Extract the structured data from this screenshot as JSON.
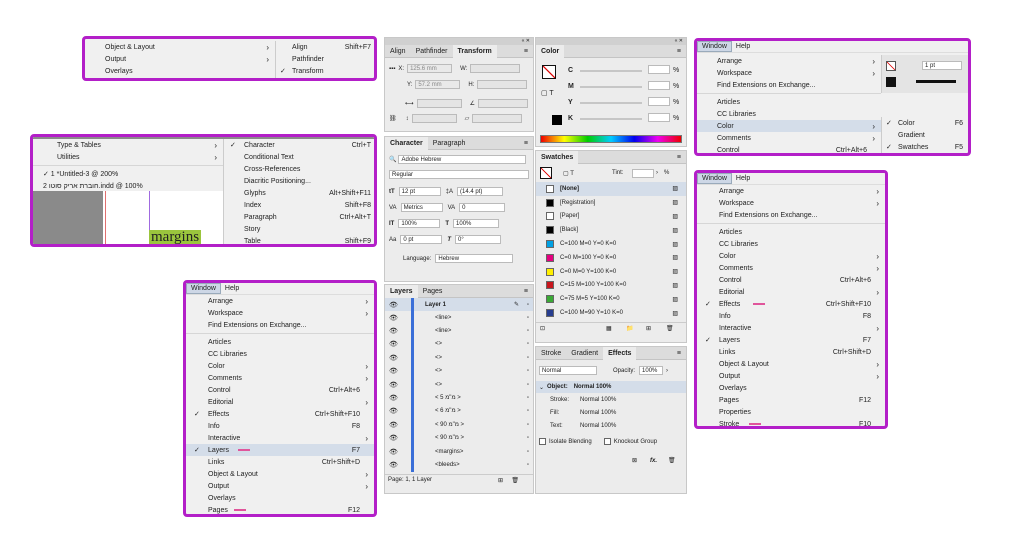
{
  "box1": {
    "items": [
      {
        "label": "Object & Layout",
        "arrow": "›"
      },
      {
        "label": "Output",
        "arrow": "›"
      },
      {
        "label": "Overlays",
        "arrow": ""
      }
    ],
    "sub": [
      {
        "label": "Align",
        "sc": "Shift+F7",
        "check": ""
      },
      {
        "label": "Pathfinder",
        "sc": "",
        "check": ""
      },
      {
        "label": "Transform",
        "sc": "",
        "check": "✓"
      }
    ]
  },
  "box2": {
    "items": [
      {
        "label": "Type & Tables",
        "arrow": "›"
      },
      {
        "label": "Utilities",
        "arrow": "›"
      }
    ],
    "docs": [
      "✓ 1 *Untitled-3 @ 200%",
      "2 חוברת אריק סוטו.indd @ 100%"
    ],
    "sub": [
      {
        "label": "Character",
        "sc": "Ctrl+T",
        "check": "✓"
      },
      {
        "label": "Conditional Text",
        "sc": "",
        "check": ""
      },
      {
        "label": "Cross-References",
        "sc": "",
        "check": ""
      },
      {
        "label": "Diacritic Positioning...",
        "sc": "",
        "check": ""
      },
      {
        "label": "Glyphs",
        "sc": "Alt+Shift+F11",
        "check": ""
      },
      {
        "label": "Index",
        "sc": "Shift+F8",
        "check": ""
      },
      {
        "label": "Paragraph",
        "sc": "Ctrl+Alt+T",
        "check": ""
      },
      {
        "label": "Story",
        "sc": "",
        "check": ""
      },
      {
        "label": "Table",
        "sc": "Shift+F9",
        "check": ""
      }
    ],
    "canvas_text": "margins"
  },
  "menubar": {
    "window": "Window",
    "help": "Help"
  },
  "box3": {
    "items": [
      {
        "label": "Arrange",
        "sc": "",
        "arrow": "›",
        "check": ""
      },
      {
        "label": "Workspace",
        "sc": "",
        "arrow": "›",
        "check": ""
      },
      {
        "label": "Find Extensions on Exchange...",
        "sc": "",
        "arrow": "",
        "check": ""
      },
      {
        "sep": true
      },
      {
        "label": "Articles",
        "sc": "",
        "arrow": "",
        "check": ""
      },
      {
        "label": "CC Libraries",
        "sc": "",
        "arrow": "",
        "check": ""
      },
      {
        "label": "Color",
        "sc": "",
        "arrow": "›",
        "check": ""
      },
      {
        "label": "Comments",
        "sc": "",
        "arrow": "›",
        "check": ""
      },
      {
        "label": "Control",
        "sc": "Ctrl+Alt+6",
        "arrow": "",
        "check": ""
      },
      {
        "label": "Editorial",
        "sc": "",
        "arrow": "›",
        "check": ""
      },
      {
        "label": "Effects",
        "sc": "Ctrl+Shift+F10",
        "arrow": "",
        "check": "✓"
      },
      {
        "label": "Info",
        "sc": "F8",
        "arrow": "",
        "check": ""
      },
      {
        "label": "Interactive",
        "sc": "",
        "arrow": "›",
        "check": ""
      },
      {
        "label": "Layers",
        "sc": "F7",
        "arrow": "",
        "check": "✓",
        "hl": true,
        "ul": true
      },
      {
        "label": "Links",
        "sc": "Ctrl+Shift+D",
        "arrow": "",
        "check": ""
      },
      {
        "label": "Object & Layout",
        "sc": "",
        "arrow": "›",
        "check": ""
      },
      {
        "label": "Output",
        "sc": "",
        "arrow": "›",
        "check": ""
      },
      {
        "label": "Overlays",
        "sc": "",
        "arrow": "",
        "check": ""
      },
      {
        "label": "Pages",
        "sc": "F12",
        "arrow": "",
        "check": "",
        "ul": true
      }
    ]
  },
  "box4": {
    "items": [
      {
        "label": "Arrange",
        "sc": "",
        "arrow": "›"
      },
      {
        "label": "Workspace",
        "sc": "",
        "arrow": "›"
      },
      {
        "label": "Find Extensions on Exchange...",
        "sc": "",
        "arrow": ""
      },
      {
        "sep": true
      },
      {
        "label": "Articles",
        "sc": "",
        "arrow": ""
      },
      {
        "label": "CC Libraries",
        "sc": "",
        "arrow": ""
      },
      {
        "label": "Color",
        "sc": "",
        "arrow": "›",
        "hl": true
      },
      {
        "label": "Comments",
        "sc": "",
        "arrow": "›"
      },
      {
        "label": "Control",
        "sc": "Ctrl+Alt+6",
        "arrow": ""
      }
    ],
    "sub": [
      {
        "label": "Color",
        "sc": "F6",
        "check": "✓"
      },
      {
        "label": "Gradient",
        "sc": "",
        "check": ""
      },
      {
        "label": "Swatches",
        "sc": "F5",
        "check": "✓"
      }
    ],
    "stroke_val": "1 pt"
  },
  "box5": {
    "items": [
      {
        "label": "Arrange",
        "sc": "",
        "arrow": "›",
        "check": ""
      },
      {
        "label": "Workspace",
        "sc": "",
        "arrow": "›",
        "check": ""
      },
      {
        "label": "Find Extensions on Exchange...",
        "sc": "",
        "arrow": "",
        "check": ""
      },
      {
        "sep": true
      },
      {
        "label": "Articles",
        "sc": "",
        "arrow": "",
        "check": ""
      },
      {
        "label": "CC Libraries",
        "sc": "",
        "arrow": "",
        "check": ""
      },
      {
        "label": "Color",
        "sc": "",
        "arrow": "›",
        "check": ""
      },
      {
        "label": "Comments",
        "sc": "",
        "arrow": "›",
        "check": ""
      },
      {
        "label": "Control",
        "sc": "Ctrl+Alt+6",
        "arrow": "",
        "check": ""
      },
      {
        "label": "Editorial",
        "sc": "",
        "arrow": "›",
        "check": ""
      },
      {
        "label": "Effects",
        "sc": "Ctrl+Shift+F10",
        "arrow": "",
        "check": "✓",
        "ul": true
      },
      {
        "label": "Info",
        "sc": "F8",
        "arrow": "",
        "check": ""
      },
      {
        "label": "Interactive",
        "sc": "",
        "arrow": "›",
        "check": ""
      },
      {
        "label": "Layers",
        "sc": "F7",
        "arrow": "",
        "check": "✓"
      },
      {
        "label": "Links",
        "sc": "Ctrl+Shift+D",
        "arrow": "",
        "check": ""
      },
      {
        "label": "Object & Layout",
        "sc": "",
        "arrow": "›",
        "check": ""
      },
      {
        "label": "Output",
        "sc": "",
        "arrow": "›",
        "check": ""
      },
      {
        "label": "Overlays",
        "sc": "",
        "arrow": "",
        "check": ""
      },
      {
        "label": "Pages",
        "sc": "F12",
        "arrow": "",
        "check": ""
      },
      {
        "label": "Properties",
        "sc": "",
        "arrow": "",
        "check": ""
      },
      {
        "label": "Stroke",
        "sc": "F10",
        "arrow": "",
        "check": "",
        "ul": true
      }
    ]
  },
  "transform": {
    "tabs": [
      "Align",
      "Pathfinder",
      "Transform"
    ],
    "x": "125.6 mm",
    "y": "57.2 mm",
    "w_label": "W:",
    "h_label": "H:",
    "x_label": "X:",
    "y_label": "Y:"
  },
  "character": {
    "tabs": [
      "Character",
      "Paragraph"
    ],
    "font": "Adobe Hebrew",
    "style": "Regular",
    "size": "12 pt",
    "leading": "(14.4 pt)",
    "kerning": "Metrics",
    "tracking": "0",
    "vscale": "100%",
    "hscale": "100%",
    "baseline": "0 pt",
    "skew": "0°",
    "lang_label": "Language:",
    "lang": "Hebrew"
  },
  "color": {
    "title": "Color",
    "channels": [
      "C",
      "M",
      "Y",
      "K"
    ],
    "pct": "%"
  },
  "swatches": {
    "title": "Swatches",
    "tint_label": "Tint:",
    "tint_pct": "%",
    "items": [
      {
        "name": "[None]",
        "color": "#ffffff",
        "sel": true
      },
      {
        "name": "[Registration]",
        "color": "#000000"
      },
      {
        "name": "[Paper]",
        "color": "#ffffff"
      },
      {
        "name": "[Black]",
        "color": "#000000"
      },
      {
        "name": "C=100 M=0 Y=0 K=0",
        "color": "#00a0e3"
      },
      {
        "name": "C=0 M=100 Y=0 K=0",
        "color": "#e4007f"
      },
      {
        "name": "C=0 M=0 Y=100 K=0",
        "color": "#ffef00"
      },
      {
        "name": "C=15 M=100 Y=100 K=0",
        "color": "#c8161d"
      },
      {
        "name": "C=75 M=5 Y=100 K=0",
        "color": "#3aa935"
      },
      {
        "name": "C=100 M=90 Y=10 K=0",
        "color": "#263d8f"
      }
    ]
  },
  "layers": {
    "tabs": [
      "Layers",
      "Pages"
    ],
    "layer": "Layer 1",
    "items": [
      "<line>",
      "<line>",
      "<>",
      "<>",
      "<>",
      "<>",
      "< 5 מ\"מ >",
      "< 6 מ\"מ >",
      "< 90 מ\"מ >",
      "< 90 מ\"מ >",
      "<margins>",
      "<bleeds>"
    ],
    "footer": "Page: 1, 1 Layer"
  },
  "effects": {
    "tabs": [
      "Stroke",
      "Gradient",
      "Effects"
    ],
    "mode": "Normal",
    "opacity_label": "Opacity:",
    "opacity": "100%",
    "object_label": "Object:",
    "object_val": "Normal 100%",
    "rows": [
      {
        "k": "Stroke:",
        "v": "Normal 100%"
      },
      {
        "k": "Fill:",
        "v": "Normal 100%"
      },
      {
        "k": "Text:",
        "v": "Normal 100%"
      }
    ],
    "isolate": "Isolate Blending",
    "knockout": "Knockout Group"
  }
}
